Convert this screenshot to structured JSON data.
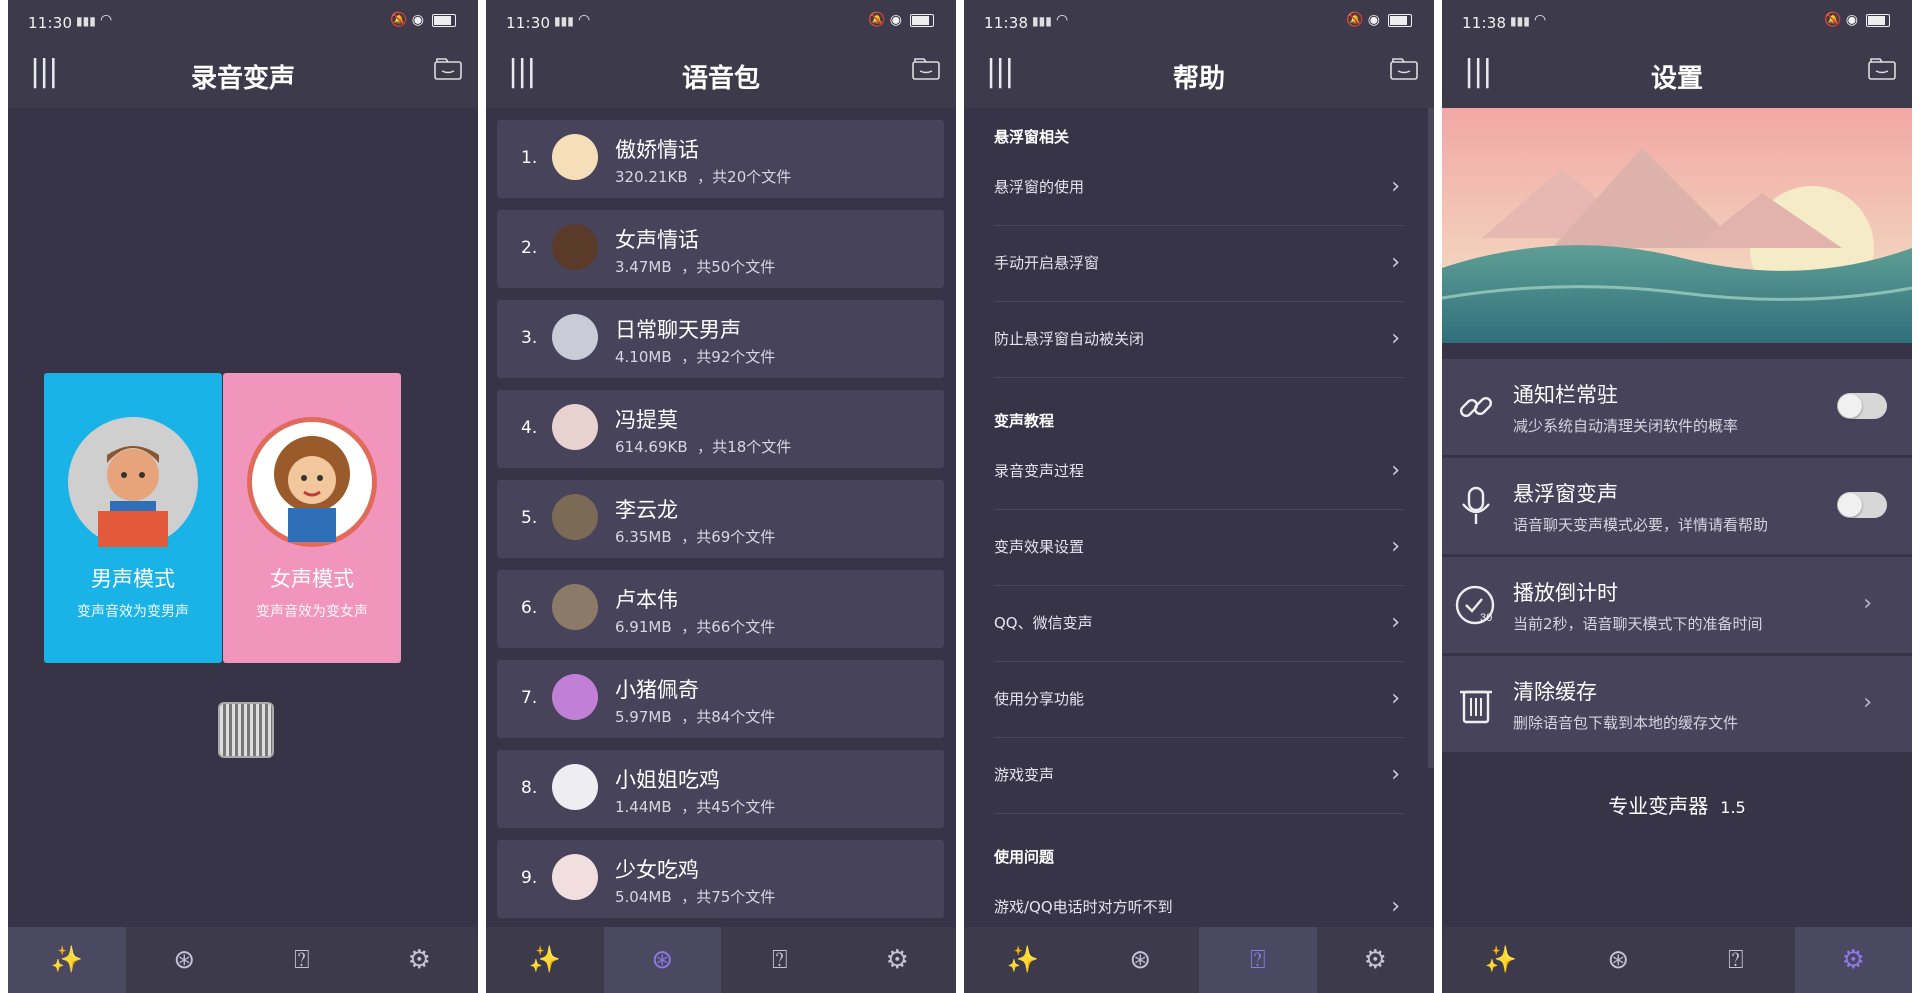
{
  "screens": [
    {
      "status": {
        "time": "11:30"
      },
      "title": "录音变声",
      "modes": [
        {
          "label": "男声模式",
          "sub": "变声音效为变男声",
          "color": "#1ab3e8"
        },
        {
          "label": "女声模式",
          "sub": "变声音效为变女声",
          "color": "#f295bd"
        }
      ],
      "nav_active": 0
    },
    {
      "status": {
        "time": "11:30"
      },
      "title": "语音包",
      "voices": [
        {
          "num": "1.",
          "name": "傲娇情话",
          "size": "320.21KB",
          "files": "，共20个文件"
        },
        {
          "num": "2.",
          "name": "女声情话",
          "size": "3.47MB",
          "files": "，共50个文件"
        },
        {
          "num": "3.",
          "name": "日常聊天男声",
          "size": "4.10MB",
          "files": "，共92个文件"
        },
        {
          "num": "4.",
          "name": "冯提莫",
          "size": "614.69KB",
          "files": "，共18个文件"
        },
        {
          "num": "5.",
          "name": "李云龙",
          "size": "6.35MB",
          "files": "，共69个文件"
        },
        {
          "num": "6.",
          "name": "卢本伟",
          "size": "6.91MB",
          "files": "，共66个文件"
        },
        {
          "num": "7.",
          "name": "小猪佩奇",
          "size": "5.97MB",
          "files": "，共84个文件"
        },
        {
          "num": "8.",
          "name": "小姐姐吃鸡",
          "size": "1.44MB",
          "files": "，共45个文件"
        },
        {
          "num": "9.",
          "name": "少女吃鸡",
          "size": "5.04MB",
          "files": "，共75个文件"
        }
      ],
      "nav_active": 1
    },
    {
      "status": {
        "time": "11:38"
      },
      "title": "帮助",
      "sections": [
        {
          "header": "悬浮窗相关",
          "items": [
            "悬浮窗的使用",
            "手动开启悬浮窗",
            "防止悬浮窗自动被关闭"
          ]
        },
        {
          "header": "变声教程",
          "items": [
            "录音变声过程",
            "变声效果设置",
            "QQ、微信变声",
            "使用分享功能",
            "游戏变声"
          ]
        },
        {
          "header": "使用问题",
          "items": [
            "游戏/QQ电话时对方听不到"
          ]
        }
      ],
      "nav_active": 2
    },
    {
      "status": {
        "time": "11:38"
      },
      "title": "设置",
      "settings": [
        {
          "name": "通知栏常驻",
          "desc": "减少系统自动清理关闭软件的概率",
          "icon": "link-icon",
          "control": "toggle"
        },
        {
          "name": "悬浮窗变声",
          "desc": "语音聊天变声模式必要，详情请看帮助",
          "icon": "microphone-icon",
          "control": "toggle"
        },
        {
          "name": "播放倒计时",
          "desc": "当前2秒，语音聊天模式下的准备时间",
          "icon": "timer-icon",
          "control": "chevron"
        },
        {
          "name": "清除缓存",
          "desc": "删除语音包下载到本地的缓存文件",
          "icon": "trash-icon",
          "control": "chevron"
        }
      ],
      "brand": "专业变声器",
      "version": "1.5",
      "nav_active": 3
    }
  ],
  "nav_icons": [
    "magic-wand-icon",
    "voice-pack-icon",
    "help-icon",
    "settings-icon"
  ]
}
